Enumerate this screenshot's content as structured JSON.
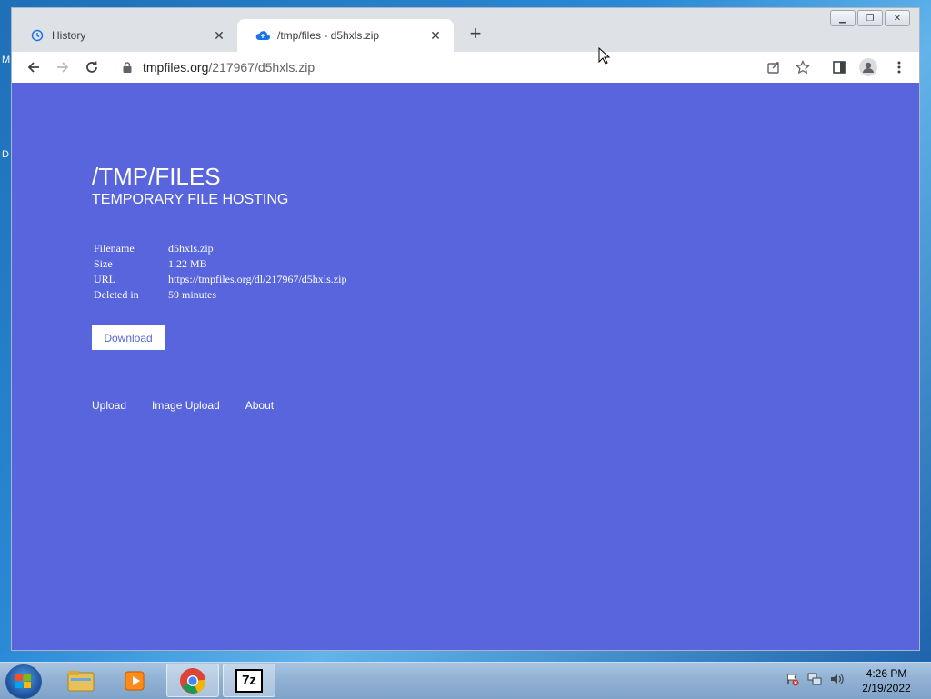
{
  "desktop": {
    "edge_letters": [
      "M",
      "D"
    ]
  },
  "browser": {
    "tabs": [
      {
        "title": "History",
        "icon": "history-icon",
        "active": false
      },
      {
        "title": "/tmp/files - d5hxls.zip",
        "icon": "cloud-upload-icon",
        "active": true
      }
    ],
    "new_tab_glyph": "+",
    "url_host": "tmpfiles.org",
    "url_path": "/217967/d5hxls.zip",
    "window_controls": [
      "minimize",
      "restore",
      "close"
    ]
  },
  "page": {
    "title": "/TMP/FILES",
    "subtitle": "TEMPORARY FILE HOSTING",
    "info": [
      {
        "key": "Filename",
        "value": "d5hxls.zip"
      },
      {
        "key": "Size",
        "value": "1.22 MB"
      },
      {
        "key": "URL",
        "value": "https://tmpfiles.org/dl/217967/d5hxls.zip"
      },
      {
        "key": "Deleted in",
        "value": "59 minutes"
      }
    ],
    "download_label": "Download",
    "nav": [
      {
        "label": "Upload"
      },
      {
        "label": "Image Upload"
      },
      {
        "label": "About"
      }
    ],
    "background_color": "#5865dc"
  },
  "taskbar": {
    "apps": [
      "file-explorer-icon",
      "media-player-icon",
      "chrome-icon",
      "7zip-icon"
    ],
    "sevenzip_label": "7z",
    "clock_time": "4:26 PM",
    "clock_date": "2/19/2022"
  }
}
